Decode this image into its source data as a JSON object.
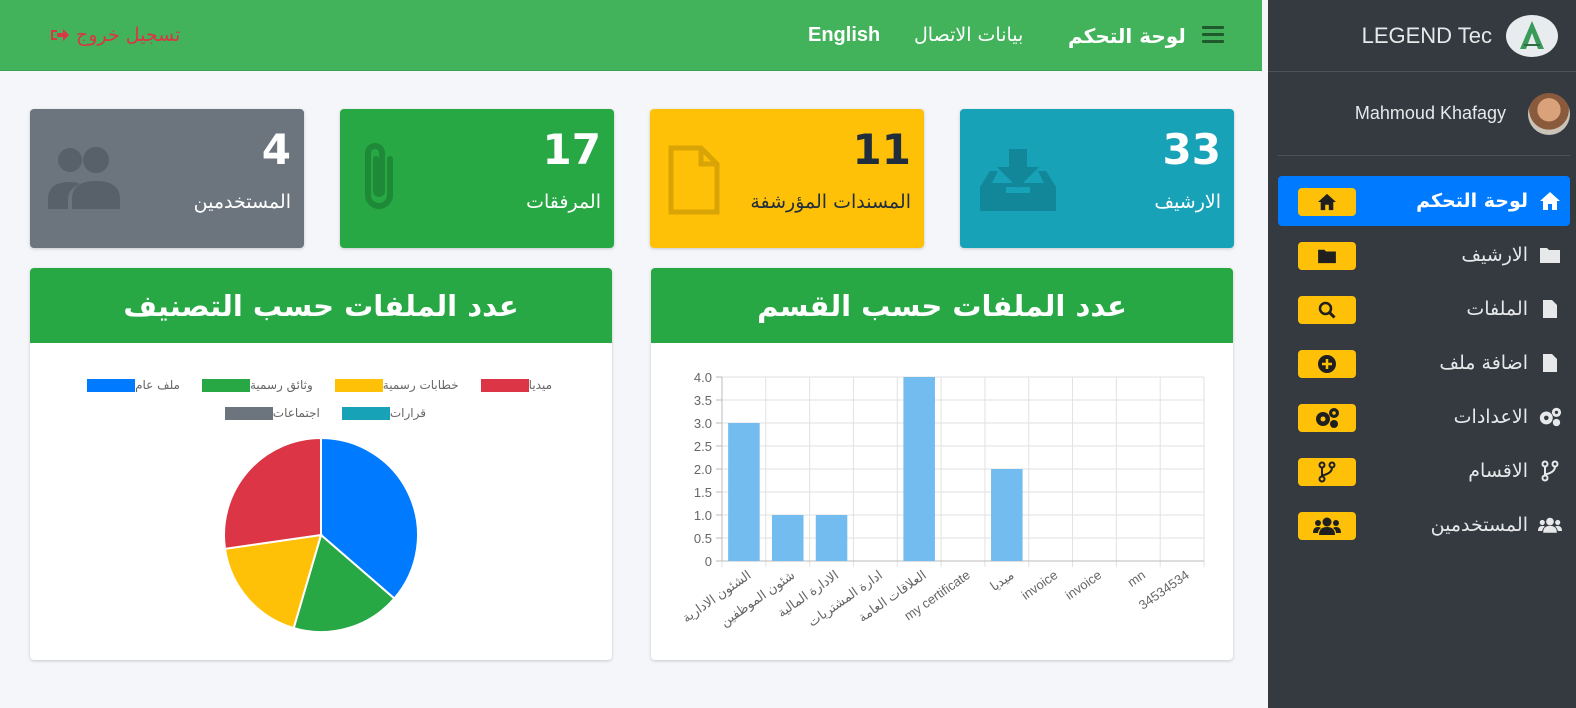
{
  "brand": {
    "name": "LEGEND Tec"
  },
  "user": {
    "name": "Mahmoud Khafagy"
  },
  "sidebar": {
    "items": [
      {
        "label": "لوحة التحكم",
        "icon": "home-icon",
        "active": true
      },
      {
        "label": "الارشيف",
        "icon": "folder-icon",
        "badge_icon": "folder-icon"
      },
      {
        "label": "الملفات",
        "icon": "file-icon",
        "badge_icon": "search-icon"
      },
      {
        "label": "اضافة ملف",
        "icon": "file-icon",
        "badge_icon": "plus-circle-icon"
      },
      {
        "label": "الاعدادات",
        "icon": "gears-icon",
        "badge_icon": "gears-icon"
      },
      {
        "label": "الاقسام",
        "icon": "branch-icon",
        "badge_icon": "branch-icon"
      },
      {
        "label": "المستخدمين",
        "icon": "users-icon",
        "badge_icon": "users-icon"
      }
    ]
  },
  "header": {
    "dashboard": "لوحة التحكم",
    "contact": "بيانات الاتصال",
    "language": "English",
    "logout": "تسجيل خروج"
  },
  "stats": [
    {
      "value": "33",
      "label": "الارشيف",
      "color": "#17a2b8",
      "icon": "inbox-download-icon"
    },
    {
      "value": "11",
      "label": "المسندات المؤرشفة",
      "color": "#ffc107",
      "icon": "file-icon"
    },
    {
      "value": "17",
      "label": "المرفقات",
      "color": "#28a745",
      "icon": "paperclip-icon"
    },
    {
      "value": "4",
      "label": "المستخدمين",
      "color": "#6c757d",
      "icon": "users-icon"
    }
  ],
  "bar_card": {
    "title": "عدد الملفات حسب القسم"
  },
  "pie_card": {
    "title": "عدد الملفات حسب التصنيف"
  },
  "chart_data": [
    {
      "type": "bar",
      "title": "عدد الملفات حسب القسم",
      "categories": [
        "الشئون الادارية",
        "شئون الموظفين",
        "الادارة المالية",
        "ادارة المشتريات",
        "العلاقات العامة",
        "my certificate",
        "ميديا",
        "invoice",
        "invoice",
        "mn",
        "34534534"
      ],
      "values": [
        3,
        1,
        1,
        0,
        4,
        0,
        2,
        0,
        0,
        0,
        0
      ],
      "ylim": [
        0,
        4
      ],
      "yticks": [
        "0",
        "0.5",
        "1.0",
        "1.5",
        "2.0",
        "2.5",
        "3.0",
        "3.5",
        "4.0"
      ],
      "grid": true,
      "color": "#72bcef"
    },
    {
      "type": "pie",
      "title": "عدد الملفات حسب التصنيف",
      "legend": "top",
      "series": [
        {
          "name": "ملف عام",
          "value": 4,
          "color": "#007bff"
        },
        {
          "name": "وثائق رسمية",
          "value": 2,
          "color": "#28a745"
        },
        {
          "name": "خطابات رسمية",
          "value": 2,
          "color": "#ffc107"
        },
        {
          "name": "ميديا",
          "value": 3,
          "color": "#dc3545"
        },
        {
          "name": "قرارات",
          "value": 0,
          "color": "#17a2b8"
        },
        {
          "name": "اجتماعات",
          "value": 0,
          "color": "#6c757d"
        }
      ]
    }
  ]
}
